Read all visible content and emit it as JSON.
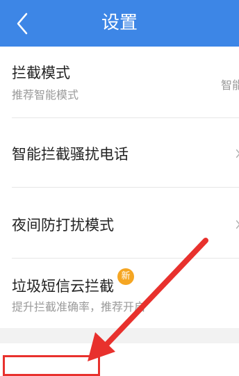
{
  "header": {
    "title": "设置",
    "back_icon": "chevron-left-icon"
  },
  "settings": [
    {
      "title": "拦截模式",
      "subtitle": "推荐智能模式",
      "value": "智能"
    },
    {
      "title": "智能拦截骚扰电话"
    },
    {
      "title": "夜间防打扰模式"
    },
    {
      "title": "垃圾短信云拦截",
      "badge": "新",
      "subtitle": "提升拦截准确率，推荐开启"
    }
  ],
  "colors": {
    "titlebar": "#3d86e6",
    "annotation_red": "#e8312d",
    "badge": "#f5a623"
  }
}
